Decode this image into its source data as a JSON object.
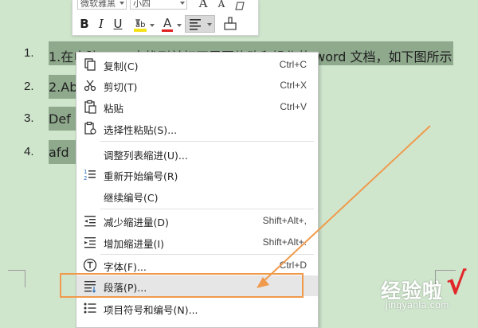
{
  "toolbar": {
    "font_name": "微软雅黑",
    "font_size": "小四",
    "grow_font": "A",
    "shrink_font": "A",
    "bold": "B",
    "italic": "I",
    "underline": "U",
    "font_color_letter": "A",
    "highlight_color": "#f3e21c",
    "font_color": "#e02020",
    "icons": [
      "bold-icon",
      "italic-icon",
      "underline-icon",
      "highlight-icon",
      "font-color-icon",
      "align-icon",
      "format-painter-icon"
    ]
  },
  "document": {
    "items": [
      {
        "num": "1.",
        "text": "1.在电脑 wps 中找到并打开需要修改和操作的 word 文档，如下图所示"
      },
      {
        "num": "2.",
        "text": "2.Ab"
      },
      {
        "num": "3.",
        "text": "Def"
      },
      {
        "num": "4.",
        "text": "afd"
      }
    ]
  },
  "context_menu": {
    "items": [
      {
        "label": "复制(C)",
        "shortcut": "Ctrl+C",
        "icon": "copy-icon"
      },
      {
        "label": "剪切(T)",
        "shortcut": "Ctrl+X",
        "icon": "cut-icon"
      },
      {
        "label": "粘贴",
        "shortcut": "Ctrl+V",
        "icon": "paste-icon"
      },
      {
        "label": "选择性粘贴(S)...",
        "shortcut": "",
        "icon": "paste-special-icon"
      },
      {
        "label": "调整列表缩进(U)...",
        "shortcut": "",
        "icon": ""
      },
      {
        "label": "重新开始编号(R)",
        "shortcut": "",
        "icon": "restart-numbering-icon"
      },
      {
        "label": "继续编号(C)",
        "shortcut": "",
        "icon": ""
      },
      {
        "label": "减少缩进量(D)",
        "shortcut": "Shift+Alt+,",
        "icon": "decrease-indent-icon"
      },
      {
        "label": "增加缩进量(I)",
        "shortcut": "Shift+Alt+.",
        "icon": "increase-indent-icon"
      },
      {
        "label": "字体(F)...",
        "shortcut": "Ctrl+D",
        "icon": "font-icon"
      },
      {
        "label": "段落(P)...",
        "shortcut": "",
        "icon": "paragraph-icon"
      },
      {
        "label": "项目符号和编号(N)...",
        "shortcut": "",
        "icon": "bullets-numbering-icon"
      }
    ],
    "hovered": "段落(P)..."
  },
  "annotation": {
    "color": "#ef9a4c"
  },
  "watermark": {
    "text": "经验啦",
    "check": "√",
    "url": "jingyanla.com",
    "check_color": "#e1282a"
  }
}
